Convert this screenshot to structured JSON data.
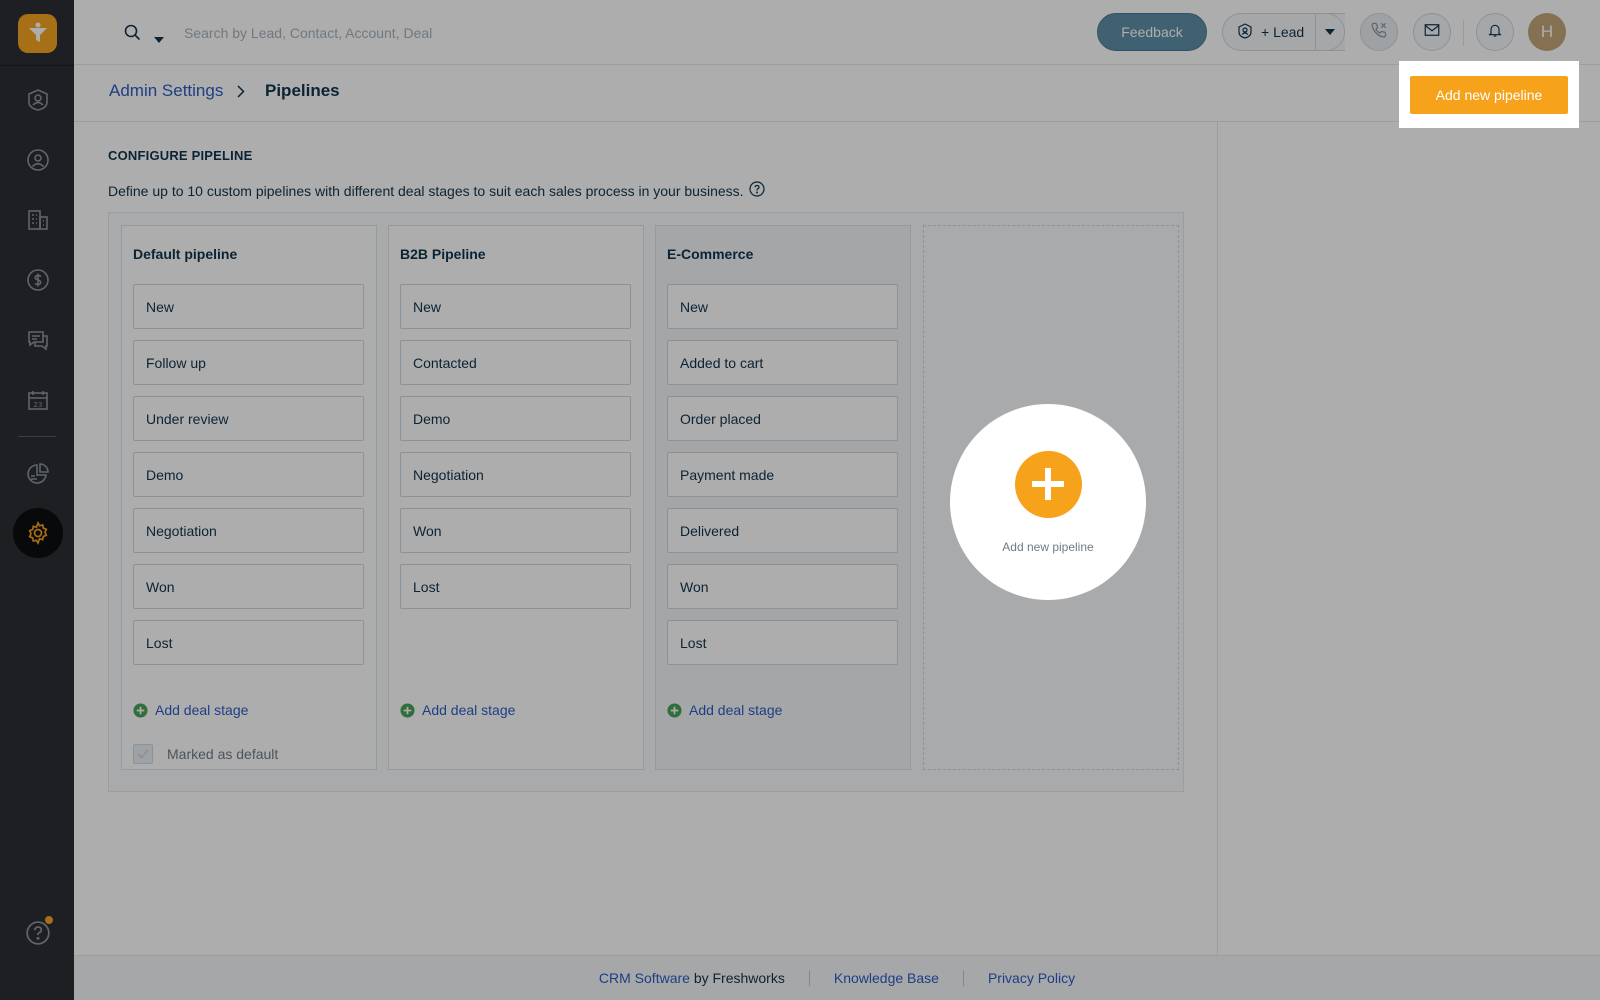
{
  "topbar": {
    "search_placeholder": "Search by Lead, Contact, Account, Deal",
    "feedback_label": "Feedback",
    "lead_label": "+ Lead",
    "avatar_initial": "H"
  },
  "breadcrumb": {
    "parent": "Admin Settings",
    "current": "Pipelines"
  },
  "actions": {
    "add_pipeline_label": "Add new pipeline"
  },
  "section": {
    "title": "CONFIGURE PIPELINE",
    "description": "Define up to 10 custom pipelines with different deal stages to suit each sales process in your business."
  },
  "pipelines": [
    {
      "name": "Default pipeline",
      "stages": [
        "New",
        "Follow up",
        "Under review",
        "Demo",
        "Negotiation",
        "Won",
        "Lost"
      ],
      "add_stage": "Add deal stage",
      "default_label": "Marked as default"
    },
    {
      "name": "B2B Pipeline",
      "stages": [
        "New",
        "Contacted",
        "Demo",
        "Negotiation",
        "Won",
        "Lost"
      ],
      "add_stage": "Add deal stage"
    },
    {
      "name": "E-Commerce",
      "stages": [
        "New",
        "Added to cart",
        "Order placed",
        "Payment made",
        "Delivered",
        "Won",
        "Lost"
      ],
      "add_stage": "Add deal stage"
    }
  ],
  "add_slot_label": "Add new pipeline",
  "footer": {
    "crm_link": "CRM Software",
    "by_text": " by Freshworks",
    "kb_link": "Knowledge Base",
    "privacy_link": "Privacy Policy"
  },
  "colors": {
    "accent": "#f7a21b",
    "sidebar": "#2b2e33",
    "link": "#2c5cc5",
    "success": "#4aa35a"
  },
  "icons": [
    "logo-icon",
    "search-icon",
    "lead-icon",
    "phone-icon",
    "mail-icon",
    "bell-icon",
    "contacts-icon",
    "accounts-icon",
    "deals-icon",
    "chat-icon",
    "calendar-icon",
    "reports-icon",
    "settings-icon",
    "help-icon"
  ]
}
